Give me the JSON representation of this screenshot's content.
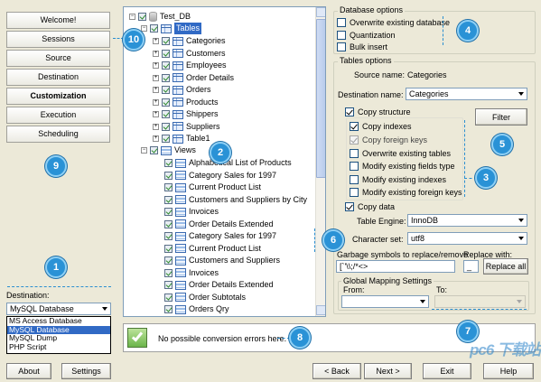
{
  "sidebar": {
    "buttons": [
      {
        "label": "Welcome!"
      },
      {
        "label": "Sessions"
      },
      {
        "label": "Source"
      },
      {
        "label": "Destination"
      },
      {
        "label": "Customization",
        "active": true
      },
      {
        "label": "Execution"
      },
      {
        "label": "Scheduling"
      }
    ],
    "destination_label": "Destination:",
    "destination_value": "MySQL Database",
    "destination_options": [
      "MS Access Database",
      "MySQL Database",
      "MySQL Dump",
      "PHP Script"
    ],
    "destination_selected": "MySQL Database"
  },
  "tree": {
    "root": "Test_DB",
    "tables_node": "Tables",
    "tables": [
      "Categories",
      "Customers",
      "Employees",
      "Order Details",
      "Orders",
      "Products",
      "Shippers",
      "Suppliers",
      "Table1"
    ],
    "views_node": "Views",
    "views": [
      "Alphabetical List of Products",
      "Category Sales for 1997",
      "Current Product List",
      "Customers and Suppliers by City",
      "Invoices",
      "Order Details Extended",
      "Category Sales for 1997",
      "Current Product List",
      "Customers and Suppliers",
      "Invoices",
      "Order Details Extended",
      "Order Subtotals",
      "Orders Qry"
    ]
  },
  "database_options": {
    "title": "Database options",
    "items": [
      {
        "label": "Overwrite existing database",
        "checked": false
      },
      {
        "label": "Quantization",
        "checked": false
      },
      {
        "label": "Bulk insert",
        "checked": false
      }
    ]
  },
  "tables_options": {
    "title": "Tables options",
    "source_name_label": "Source name:",
    "source_name_value": "Categories",
    "destination_name_label": "Destination name:",
    "destination_name_value": "Categories",
    "copy_structure": {
      "label": "Copy structure",
      "checked": true
    },
    "structure_items": [
      {
        "label": "Copy indexes",
        "checked": true,
        "enabled": true
      },
      {
        "label": "Copy foreign keys",
        "checked": true,
        "enabled": false
      },
      {
        "label": "Overwrite existing tables",
        "checked": false,
        "enabled": true
      },
      {
        "label": "Modify existing fields type",
        "checked": false,
        "enabled": true
      },
      {
        "label": "Modify existing indexes",
        "checked": false,
        "enabled": true
      },
      {
        "label": "Modify existing foreign keys",
        "checked": false,
        "enabled": true
      }
    ],
    "filter_label": "Filter",
    "copy_data": {
      "label": "Copy data",
      "checked": true
    },
    "table_engine_label": "Table Engine:",
    "table_engine_value": "InnoDB",
    "charset_label": "Character set:",
    "charset_value": "utf8",
    "garbage_label": "Garbage symbols to replace/remove",
    "garbage_value": "[`'\\\\;/*<>",
    "replace_with_label": "Replace with:",
    "replace_with_value": "_",
    "replace_all_label": "Replace all",
    "global_mapping_title": "Global Mapping Settings",
    "from_label": "From:",
    "to_label": "To:"
  },
  "status": {
    "message": "No possible conversion errors here."
  },
  "footer": {
    "about": "About",
    "settings": "Settings",
    "back": "< Back",
    "next": "Next >",
    "exit": "Exit",
    "help": "Help"
  },
  "callouts": [
    "1",
    "2",
    "3",
    "4",
    "5",
    "6",
    "7",
    "8",
    "9",
    "10"
  ],
  "watermark": "pc6 下载站",
  "colors": {
    "callout": "#2a92d6",
    "selection": "#316ac5",
    "dialog_bg": "#ece9d8"
  }
}
